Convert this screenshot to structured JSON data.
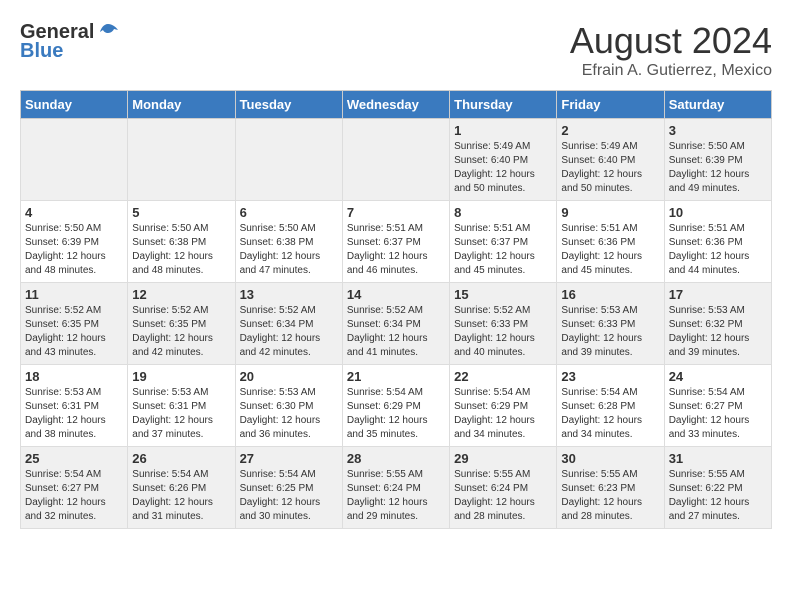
{
  "header": {
    "logo_general": "General",
    "logo_blue": "Blue",
    "month_title": "August 2024",
    "subtitle": "Efrain A. Gutierrez, Mexico"
  },
  "days_of_week": [
    "Sunday",
    "Monday",
    "Tuesday",
    "Wednesday",
    "Thursday",
    "Friday",
    "Saturday"
  ],
  "weeks": [
    [
      {
        "day": "",
        "info": ""
      },
      {
        "day": "",
        "info": ""
      },
      {
        "day": "",
        "info": ""
      },
      {
        "day": "",
        "info": ""
      },
      {
        "day": "1",
        "info": "Sunrise: 5:49 AM\nSunset: 6:40 PM\nDaylight: 12 hours\nand 50 minutes."
      },
      {
        "day": "2",
        "info": "Sunrise: 5:49 AM\nSunset: 6:40 PM\nDaylight: 12 hours\nand 50 minutes."
      },
      {
        "day": "3",
        "info": "Sunrise: 5:50 AM\nSunset: 6:39 PM\nDaylight: 12 hours\nand 49 minutes."
      }
    ],
    [
      {
        "day": "4",
        "info": "Sunrise: 5:50 AM\nSunset: 6:39 PM\nDaylight: 12 hours\nand 48 minutes."
      },
      {
        "day": "5",
        "info": "Sunrise: 5:50 AM\nSunset: 6:38 PM\nDaylight: 12 hours\nand 48 minutes."
      },
      {
        "day": "6",
        "info": "Sunrise: 5:50 AM\nSunset: 6:38 PM\nDaylight: 12 hours\nand 47 minutes."
      },
      {
        "day": "7",
        "info": "Sunrise: 5:51 AM\nSunset: 6:37 PM\nDaylight: 12 hours\nand 46 minutes."
      },
      {
        "day": "8",
        "info": "Sunrise: 5:51 AM\nSunset: 6:37 PM\nDaylight: 12 hours\nand 45 minutes."
      },
      {
        "day": "9",
        "info": "Sunrise: 5:51 AM\nSunset: 6:36 PM\nDaylight: 12 hours\nand 45 minutes."
      },
      {
        "day": "10",
        "info": "Sunrise: 5:51 AM\nSunset: 6:36 PM\nDaylight: 12 hours\nand 44 minutes."
      }
    ],
    [
      {
        "day": "11",
        "info": "Sunrise: 5:52 AM\nSunset: 6:35 PM\nDaylight: 12 hours\nand 43 minutes."
      },
      {
        "day": "12",
        "info": "Sunrise: 5:52 AM\nSunset: 6:35 PM\nDaylight: 12 hours\nand 42 minutes."
      },
      {
        "day": "13",
        "info": "Sunrise: 5:52 AM\nSunset: 6:34 PM\nDaylight: 12 hours\nand 42 minutes."
      },
      {
        "day": "14",
        "info": "Sunrise: 5:52 AM\nSunset: 6:34 PM\nDaylight: 12 hours\nand 41 minutes."
      },
      {
        "day": "15",
        "info": "Sunrise: 5:52 AM\nSunset: 6:33 PM\nDaylight: 12 hours\nand 40 minutes."
      },
      {
        "day": "16",
        "info": "Sunrise: 5:53 AM\nSunset: 6:33 PM\nDaylight: 12 hours\nand 39 minutes."
      },
      {
        "day": "17",
        "info": "Sunrise: 5:53 AM\nSunset: 6:32 PM\nDaylight: 12 hours\nand 39 minutes."
      }
    ],
    [
      {
        "day": "18",
        "info": "Sunrise: 5:53 AM\nSunset: 6:31 PM\nDaylight: 12 hours\nand 38 minutes."
      },
      {
        "day": "19",
        "info": "Sunrise: 5:53 AM\nSunset: 6:31 PM\nDaylight: 12 hours\nand 37 minutes."
      },
      {
        "day": "20",
        "info": "Sunrise: 5:53 AM\nSunset: 6:30 PM\nDaylight: 12 hours\nand 36 minutes."
      },
      {
        "day": "21",
        "info": "Sunrise: 5:54 AM\nSunset: 6:29 PM\nDaylight: 12 hours\nand 35 minutes."
      },
      {
        "day": "22",
        "info": "Sunrise: 5:54 AM\nSunset: 6:29 PM\nDaylight: 12 hours\nand 34 minutes."
      },
      {
        "day": "23",
        "info": "Sunrise: 5:54 AM\nSunset: 6:28 PM\nDaylight: 12 hours\nand 34 minutes."
      },
      {
        "day": "24",
        "info": "Sunrise: 5:54 AM\nSunset: 6:27 PM\nDaylight: 12 hours\nand 33 minutes."
      }
    ],
    [
      {
        "day": "25",
        "info": "Sunrise: 5:54 AM\nSunset: 6:27 PM\nDaylight: 12 hours\nand 32 minutes."
      },
      {
        "day": "26",
        "info": "Sunrise: 5:54 AM\nSunset: 6:26 PM\nDaylight: 12 hours\nand 31 minutes."
      },
      {
        "day": "27",
        "info": "Sunrise: 5:54 AM\nSunset: 6:25 PM\nDaylight: 12 hours\nand 30 minutes."
      },
      {
        "day": "28",
        "info": "Sunrise: 5:55 AM\nSunset: 6:24 PM\nDaylight: 12 hours\nand 29 minutes."
      },
      {
        "day": "29",
        "info": "Sunrise: 5:55 AM\nSunset: 6:24 PM\nDaylight: 12 hours\nand 28 minutes."
      },
      {
        "day": "30",
        "info": "Sunrise: 5:55 AM\nSunset: 6:23 PM\nDaylight: 12 hours\nand 28 minutes."
      },
      {
        "day": "31",
        "info": "Sunrise: 5:55 AM\nSunset: 6:22 PM\nDaylight: 12 hours\nand 27 minutes."
      }
    ]
  ]
}
